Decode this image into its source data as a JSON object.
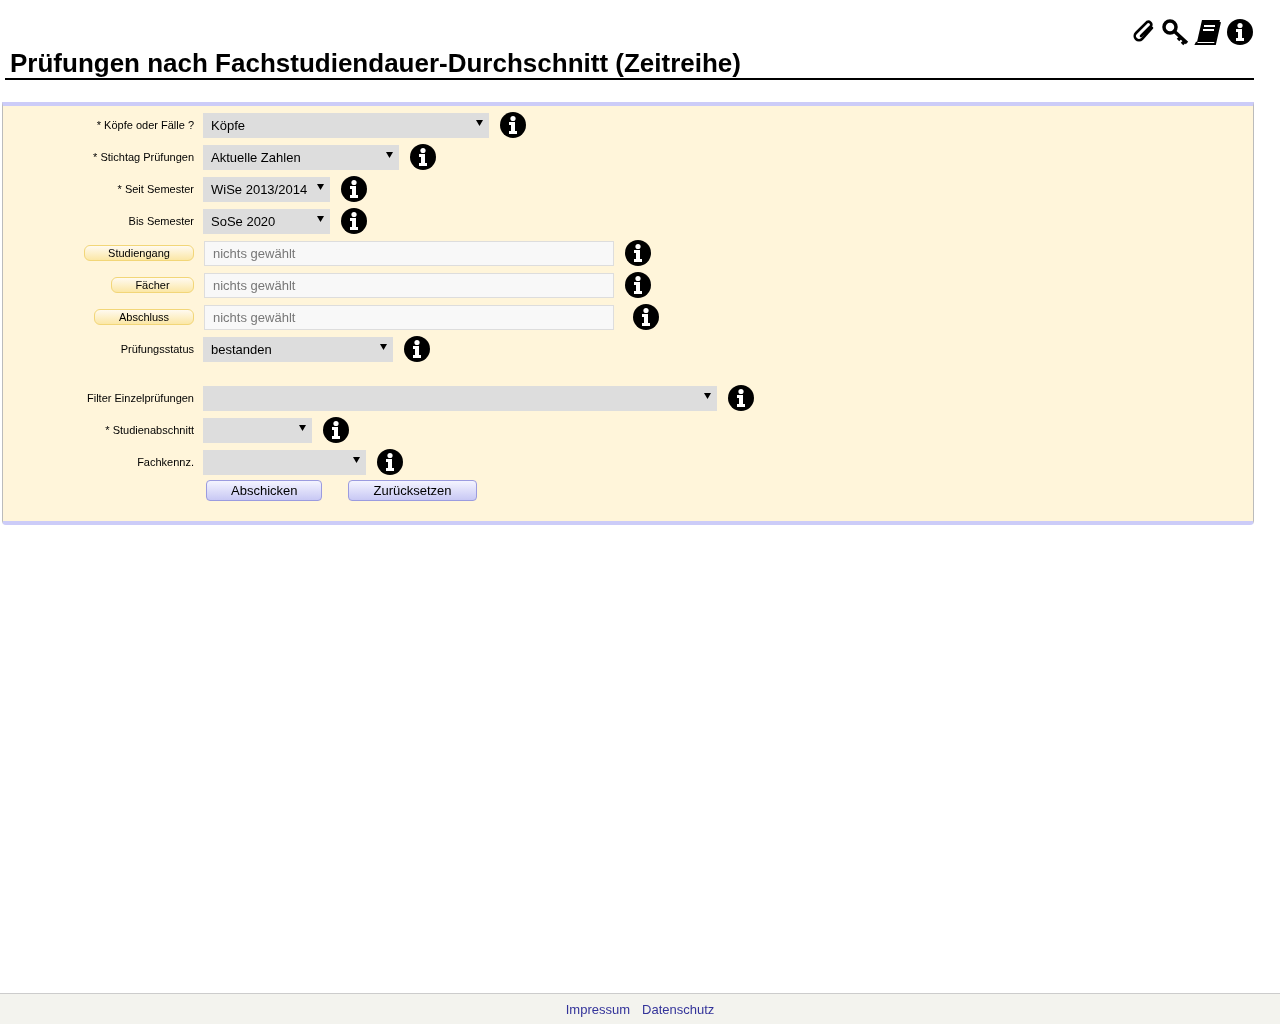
{
  "title": "Prüfungen nach Fachstudiendauer-Durchschnitt (Zeitreihe)",
  "form": {
    "rows": [
      {
        "kind": "select",
        "label": "* Köpfe oder Fälle ?",
        "value": "Köpfe"
      },
      {
        "kind": "select",
        "label": "* Stichtag Prüfungen",
        "value": "Aktuelle Zahlen"
      },
      {
        "kind": "select",
        "label": "* Seit Semester",
        "value": "WiSe 2013/2014"
      },
      {
        "kind": "select",
        "label": "Bis Semester",
        "value": "SoSe 2020"
      },
      {
        "kind": "picker",
        "label": "Studiengang",
        "placeholder": "nichts gewählt"
      },
      {
        "kind": "picker",
        "label": "Fächer",
        "placeholder": "nichts gewählt"
      },
      {
        "kind": "picker",
        "label": "Abschluss",
        "placeholder": "nichts gewählt"
      },
      {
        "kind": "select",
        "label": "Prüfungsstatus",
        "value": "bestanden"
      },
      {
        "kind": "select",
        "label": "Filter Einzelprüfungen"
      },
      {
        "kind": "select",
        "label": "* Studienabschnitt"
      },
      {
        "kind": "select",
        "label": "Fachkennz."
      }
    ],
    "buttons": [
      "Abschicken",
      "Zurücksetzen"
    ]
  },
  "footer": {
    "links": [
      "Impressum",
      "Datenschutz"
    ]
  }
}
